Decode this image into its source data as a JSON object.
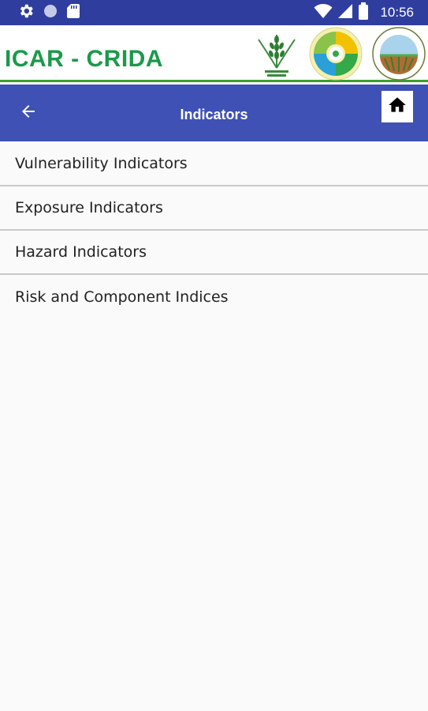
{
  "status_bar": {
    "time": "10:56",
    "left_icons": [
      "gear-icon",
      "circle-icon",
      "sd-card-icon"
    ],
    "right_icons": [
      "wifi-icon",
      "signal-icon",
      "battery-icon"
    ]
  },
  "banner": {
    "brand": "ICAR - CRIDA",
    "logos": [
      "icar-logo",
      "nicra-logo",
      "crida-seal-logo"
    ]
  },
  "app_bar": {
    "title": "Indicators",
    "back_icon": "arrow-left-icon",
    "home_icon": "home-icon",
    "color": "#3f51b5"
  },
  "menu": {
    "items": [
      {
        "label": "Vulnerability Indicators"
      },
      {
        "label": "Exposure Indicators"
      },
      {
        "label": "Hazard Indicators"
      },
      {
        "label": "Risk and Component Indices"
      }
    ]
  },
  "colors": {
    "status_bar": "#2f3e9e",
    "brand_green": "#1a9a4a",
    "accent_green": "#3aa02b"
  }
}
